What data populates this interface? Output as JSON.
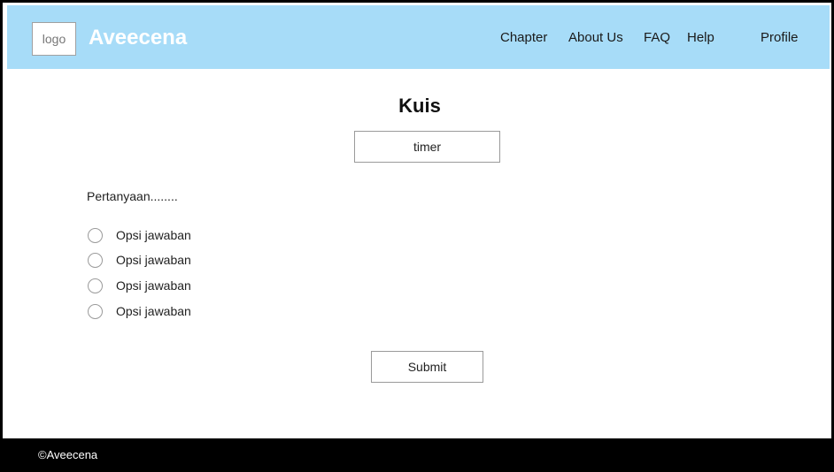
{
  "header": {
    "logo_label": "logo",
    "brand": "Aveecena",
    "nav": [
      "Chapter",
      "About Us",
      "FAQ",
      "Help",
      "Profile"
    ]
  },
  "quiz": {
    "title": "Kuis",
    "timer": "timer",
    "question": "Pertanyaan........",
    "options": [
      "Opsi jawaban",
      "Opsi jawaban",
      "Opsi jawaban",
      "Opsi jawaban"
    ],
    "submit_label": "Submit"
  },
  "footer": {
    "copyright": "©Aveecena"
  },
  "colors": {
    "header_bg": "#a7dcf8",
    "footer_bg": "#000000",
    "brand_text": "#ffffff"
  }
}
